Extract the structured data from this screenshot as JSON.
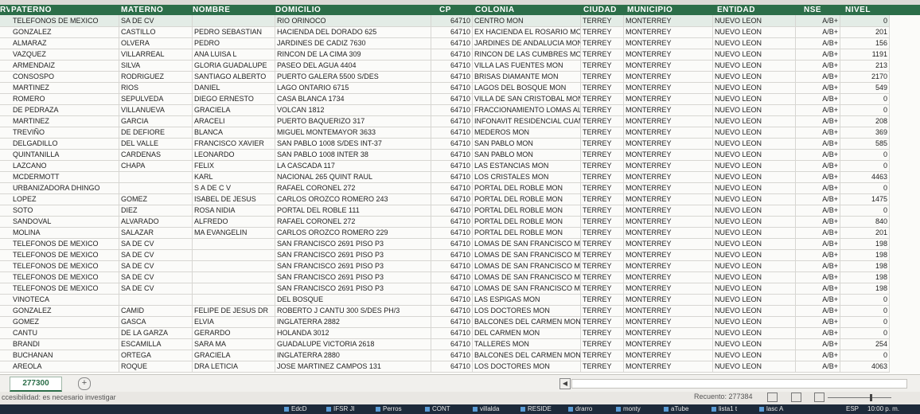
{
  "columns": [
    "PATERNO",
    "MATERNO",
    "NOMBRE",
    "DOMICILIO",
    "CP",
    "COLONIA",
    "CIUDAD",
    "MUNICIPIO",
    "ENTIDAD",
    "NSE",
    "NIVEL"
  ],
  "header_prefix": "RV",
  "rows": [
    [
      "TELEFONOS DE MEXICO",
      "SA DE CV",
      "",
      "RIO ORINOCO",
      "64710",
      "CENTRO       MON",
      "TERREY",
      "MONTERREY",
      "NUEVO LEON",
      "A/B+",
      "0"
    ],
    [
      "GONZALEZ",
      "CASTILLO",
      "PEDRO SEBASTIAN",
      "HACIENDA DEL DORADO 625",
      "64710",
      "EX HACIENDA EL ROSARIO  MON",
      "TERREY",
      "MONTERREY",
      "NUEVO LEON",
      "A/B+",
      "201"
    ],
    [
      "ALMARAZ",
      "OLVERA",
      "PEDRO",
      "JARDINES DE CADIZ 7630",
      "64710",
      "JARDINES DE ANDALUCIA  MON",
      "TERREY",
      "MONTERREY",
      "NUEVO LEON",
      "A/B+",
      "156"
    ],
    [
      "VAZQUEZ",
      "VILLARREAL",
      "ANA LUISA L",
      "RINCON DE LA CIMA 309",
      "64710",
      "RINCON DE LAS CUMBRES  MON",
      "TERREY",
      "MONTERREY",
      "NUEVO LEON",
      "A/B+",
      "1191"
    ],
    [
      "ARMENDAIZ",
      "SILVA",
      "GLORIA GUADALUPE",
      "PASEO DEL AGUA 4404",
      "64710",
      "VILLA LAS FUENTES    MON",
      "TERREY",
      "MONTERREY",
      "NUEVO LEON",
      "A/B+",
      "213"
    ],
    [
      "CONSOSPO",
      "RODRIGUEZ",
      "SANTIAGO ALBERTO",
      "PUERTO GALERA 5500 S/DES",
      "64710",
      "BRISAS DIAMANTE      MON",
      "TERREY",
      "MONTERREY",
      "NUEVO LEON",
      "A/B+",
      "2170"
    ],
    [
      "MARTINEZ",
      "RIOS",
      "DANIEL",
      "LAGO ONTARIO 6715",
      "64710",
      "LAGOS DEL BOSQUE     MON",
      "TERREY",
      "MONTERREY",
      "NUEVO LEON",
      "A/B+",
      "549"
    ],
    [
      "ROMERO",
      "SEPULVEDA",
      "DIEGO ERNESTO",
      "CASA BLANCA 1734",
      "64710",
      "VILLA DE SAN CRISTOBAL  MON",
      "TERREY",
      "MONTERREY",
      "NUEVO LEON",
      "A/B+",
      "0"
    ],
    [
      "DE PEDRAZA",
      "VILLANUEVA",
      "GRACIELA",
      "VOLCAN 1812",
      "64710",
      "FRACCIONAMIENTO LOMAS ALTI",
      "TERREY",
      "MONTERREY",
      "NUEVO LEON",
      "A/B+",
      "0"
    ],
    [
      "MARTINEZ",
      "GARCIA",
      "ARACELI",
      "PUERTO BAQUERIZO 317",
      "64710",
      "INFONAVIT RESIDENCIAL CUAMC",
      "TERREY",
      "MONTERREY",
      "NUEVO LEON",
      "A/B+",
      "208"
    ],
    [
      "TREVIÑO",
      "DE DEFIORE",
      "BLANCA",
      "MIGUEL MONTEMAYOR 3633",
      "64710",
      "MEDEROS        MON",
      "TERREY",
      "MONTERREY",
      "NUEVO LEON",
      "A/B+",
      "369"
    ],
    [
      "DELGADILLO",
      "DEL VALLE",
      "FRANCISCO XAVIER",
      "SAN PABLO 1008 S/DES INT-37",
      "64710",
      "SAN PABLO       MON",
      "TERREY",
      "MONTERREY",
      "NUEVO LEON",
      "A/B+",
      "585"
    ],
    [
      "QUINTANILLA",
      "CARDENAS",
      "LEONARDO",
      "SAN PABLO 1008 INTER 38",
      "64710",
      "SAN PABLO       MON",
      "TERREY",
      "MONTERREY",
      "NUEVO LEON",
      "A/B+",
      "0"
    ],
    [
      "LAZCANO",
      "CHAPA",
      "FELIX",
      "LA CASCADA 117",
      "64710",
      "LAS ESTANCIAS     MON",
      "TERREY",
      "MONTERREY",
      "NUEVO LEON",
      "A/B+",
      "0"
    ],
    [
      "MCDERMOTT",
      "",
      "KARL",
      "NACIONAL 265 QUINT RAUL",
      "64710",
      "LOS CRISTALES     MON",
      "TERREY",
      "MONTERREY",
      "NUEVO LEON",
      "A/B+",
      "4463"
    ],
    [
      "URBANIZADORA DHINGO",
      "",
      "S A DE C V",
      "RAFAEL CORONEL 272",
      "64710",
      "PORTAL DEL ROBLE    MON",
      "TERREY",
      "MONTERREY",
      "NUEVO LEON",
      "A/B+",
      "0"
    ],
    [
      "LOPEZ",
      "GOMEZ",
      "ISABEL DE JESUS",
      "CARLOS OROZCO ROMERO 243",
      "64710",
      "PORTAL DEL ROBLE    MON",
      "TERREY",
      "MONTERREY",
      "NUEVO LEON",
      "A/B+",
      "1475"
    ],
    [
      "SOTO",
      "DIEZ",
      "ROSA NIDIA",
      "PORTAL DEL ROBLE 111",
      "64710",
      "PORTAL DEL ROBLE    MON",
      "TERREY",
      "MONTERREY",
      "NUEVO LEON",
      "A/B+",
      "0"
    ],
    [
      "SANDOVAL",
      "ALVARADO",
      "ALFREDO",
      "RAFAEL CORONEL 272",
      "64710",
      "PORTAL DEL ROBLE    MON",
      "TERREY",
      "MONTERREY",
      "NUEVO LEON",
      "A/B+",
      "840"
    ],
    [
      "MOLINA",
      "SALAZAR",
      "MA EVANGELIN",
      "CARLOS OROZCO ROMERO 229",
      "64710",
      "PORTAL DEL ROBLE    MON",
      "TERREY",
      "MONTERREY",
      "NUEVO LEON",
      "A/B+",
      "201"
    ],
    [
      "TELEFONOS DE MEXICO",
      "SA DE CV",
      "",
      "SAN FRANCISCO 2691 PISO P3",
      "64710",
      "LOMAS DE SAN FRANCISCO  MC",
      "TERREY",
      "MONTERREY",
      "NUEVO LEON",
      "A/B+",
      "198"
    ],
    [
      "TELEFONOS DE MEXICO",
      "SA DE CV",
      "",
      "SAN FRANCISCO 2691 PISO P3",
      "64710",
      "LOMAS DE SAN FRANCISCO  MC",
      "TERREY",
      "MONTERREY",
      "NUEVO LEON",
      "A/B+",
      "198"
    ],
    [
      "TELEFONOS DE MEXICO",
      "SA DE CV",
      "",
      "SAN FRANCISCO 2691 PISO P3",
      "64710",
      "LOMAS DE SAN FRANCISCO  MC",
      "TERREY",
      "MONTERREY",
      "NUEVO LEON",
      "A/B+",
      "198"
    ],
    [
      "TELEFONOS DE MEXICO",
      "SA DE CV",
      "",
      "SAN FRANCISCO 2691 PISO P3",
      "64710",
      "LOMAS DE SAN FRANCISCO  MC",
      "TERREY",
      "MONTERREY",
      "NUEVO LEON",
      "A/B+",
      "198"
    ],
    [
      "TELEFONOS DE MEXICO",
      "SA DE CV",
      "",
      "SAN FRANCISCO 2691 PISO P3",
      "64710",
      "LOMAS DE SAN FRANCISCO  MC",
      "TERREY",
      "MONTERREY",
      "NUEVO LEON",
      "A/B+",
      "198"
    ],
    [
      "VINOTECA",
      "",
      "",
      "DEL BOSQUE",
      "64710",
      "LAS ESPIGAS      MON",
      "TERREY",
      "MONTERREY",
      "NUEVO LEON",
      "A/B+",
      "0"
    ],
    [
      "GONZALEZ",
      "CAMID",
      "FELIPE DE JESUS DR",
      "ROBERTO J CANTU 300 S/DES PH/3",
      "64710",
      "LOS DOCTORES      MON",
      "TERREY",
      "MONTERREY",
      "NUEVO LEON",
      "A/B+",
      "0"
    ],
    [
      "GOMEZ",
      "GASCA",
      "ELVIA",
      "INGLATERRA 2882",
      "64710",
      "BALCONES DEL CARMEN   MON",
      "TERREY",
      "MONTERREY",
      "NUEVO LEON",
      "A/B+",
      "0"
    ],
    [
      "CANTU",
      "DE LA GARZA",
      "GERARDO",
      "HOLANDA 3012",
      "64710",
      "DEL CARMEN        MON",
      "TERREY",
      "MONTERREY",
      "NUEVO LEON",
      "A/B+",
      "0"
    ],
    [
      "BRANDI",
      "ESCAMILLA",
      "SARA MA",
      "GUADALUPE VICTORIA 2618",
      "64710",
      "TALLERES        MON",
      "TERREY",
      "MONTERREY",
      "NUEVO LEON",
      "A/B+",
      "254"
    ],
    [
      "BUCHANAN",
      "ORTEGA",
      "GRACIELA",
      "INGLATERRA 2880",
      "64710",
      "BALCONES DEL CARMEN   MON",
      "TERREY",
      "MONTERREY",
      "NUEVO LEON",
      "A/B+",
      "0"
    ],
    [
      "AREOLA",
      "ROQUE",
      "DRA LETICIA",
      "JOSE MARTINEZ CAMPOS 131",
      "64710",
      "LOS DOCTORES      MON",
      "TERREY",
      "MONTERREY",
      "NUEVO LEON",
      "A/B+",
      "4063"
    ]
  ],
  "sheet_tab": "277300",
  "add_sheet": "+",
  "status": {
    "accessibility": "ccesibilidad: es necesario investigar",
    "count": "Recuento: 277384"
  },
  "taskbar": [
    "EdcD",
    "IFSR JI",
    "Perros",
    "CONT",
    "villalda",
    "RESIDE",
    "drarro",
    "monty",
    "aTube",
    "lista1 t",
    "lasc A"
  ],
  "tray": {
    "lang": "ESP",
    "time": "10:00 p. m."
  },
  "colors": {
    "header_bg": "#2c6e49",
    "header_text": "#ffffff",
    "grid": "#d7d6d2",
    "sheet_bg": "#fbfbf9"
  }
}
